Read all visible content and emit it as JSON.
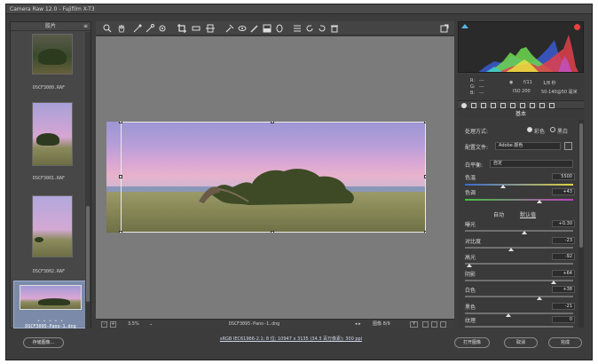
{
  "window": {
    "title": "Camera Raw 12.0 - Fujifilm X-T3"
  },
  "filmstrip": {
    "header": "胶片",
    "thumbnails": [
      {
        "label": "DSCF3000.RAF"
      },
      {
        "label": "DSCF3001.RAF"
      },
      {
        "label": "DSCF3002.RAF"
      },
      {
        "label": "DSCF3095-Pano-1.dng"
      }
    ],
    "stars": "• • • • •"
  },
  "canvas_status": {
    "zoom": "3.5%",
    "filename": "DSCF3095-Pano-1.dng",
    "image_count": "图像 8/9",
    "y_label": "Y"
  },
  "histogram": {
    "colors": {
      "red": "#e0404a",
      "green": "#6fd850",
      "blue": "#3a5ad0",
      "yellow": "#e8e040",
      "cyan": "#40c8d0",
      "magenta": "#c050c0"
    }
  },
  "exif": {
    "r_label": "R:",
    "g_label": "G:",
    "b_label": "B:",
    "rgb_values": [
      "---",
      "---",
      "---"
    ],
    "aperture": "f/11",
    "shutter": "1/8 秒",
    "iso": "ISO 200",
    "lens": "50-140@50 毫米"
  },
  "panel": {
    "title": "基本",
    "treatment_label": "处理方式:",
    "treatment_color": "彩色",
    "treatment_bw": "黑白",
    "profile_label": "配置文件:",
    "profile_value": "Adobe 颜色",
    "wb_label": "白平衡:",
    "wb_value": "自定",
    "temp_label": "色温",
    "temp_value": "5500",
    "tint_label": "色调",
    "tint_value": "+43",
    "auto_label": "自动",
    "default_label": "默认值",
    "sliders": [
      {
        "label": "曝光",
        "value": "+0.30",
        "pos": 0.55
      },
      {
        "label": "对比度",
        "value": "-23",
        "pos": 0.43
      },
      {
        "label": "高光",
        "value": "-92",
        "pos": 0.04
      },
      {
        "label": "阴影",
        "value": "+64",
        "pos": 0.82
      },
      {
        "label": "白色",
        "value": "+38",
        "pos": 0.69
      },
      {
        "label": "黑色",
        "value": "-21",
        "pos": 0.4
      }
    ],
    "texture_label": "纹理",
    "texture_value": "0"
  },
  "footer": {
    "save_button": "存储图像...",
    "info_link": "sRGB IEC61966-2.1; 8 位; 10947 x 3135 (34.3 百万像素); 300 ppi",
    "open_button": "打开图像",
    "cancel_button": "取消",
    "done_button": "完成"
  }
}
